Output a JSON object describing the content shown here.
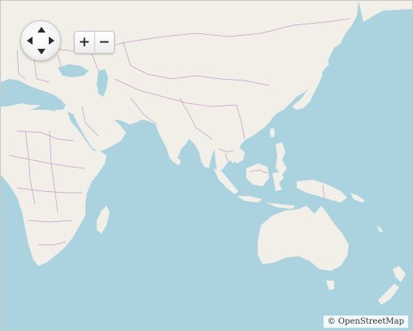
{
  "map": {
    "colors": {
      "water": "#aad3df",
      "land": "#f2efe9",
      "border": "#c69bc9"
    }
  },
  "controls": {
    "pan_icon": "pan-arrows-icon",
    "zoom_in_label": "+",
    "zoom_out_label": "−"
  },
  "attribution": {
    "text": "© OpenStreetMap"
  }
}
